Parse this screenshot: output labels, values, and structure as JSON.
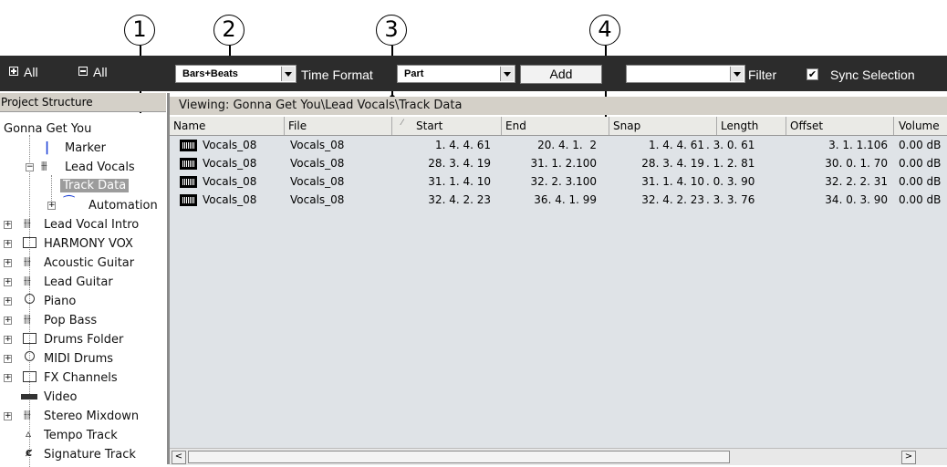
{
  "callouts": [
    "1",
    "2",
    "3",
    "4"
  ],
  "toolbar": {
    "expand_all": "All",
    "collapse_all": "All",
    "time_format_value": "Bars+Beats",
    "time_format_label": "Time Format",
    "type_value": "Part",
    "add_label": "Add",
    "filter_value": "",
    "filter_label": "Filter",
    "sync_label": "Sync Selection",
    "sync_checked": "✔"
  },
  "project_structure": {
    "header": "Project Structure",
    "root": "Gonna Get You",
    "items": [
      {
        "label": "Marker",
        "icon": "marker-icon"
      },
      {
        "label": "Lead Vocals",
        "icon": "audio-track-icon"
      },
      {
        "label": "Track Data",
        "icon": "none"
      },
      {
        "label": "Automation",
        "icon": "automation-icon"
      },
      {
        "label": "Lead Vocal Intro",
        "icon": "audio-track-icon"
      },
      {
        "label": "HARMONY VOX",
        "icon": "folder-icon"
      },
      {
        "label": "Acoustic Guitar",
        "icon": "audio-track-icon"
      },
      {
        "label": "Lead Guitar",
        "icon": "audio-track-icon"
      },
      {
        "label": "Piano",
        "icon": "midi-track-icon"
      },
      {
        "label": "Pop Bass",
        "icon": "audio-track-icon"
      },
      {
        "label": "Drums Folder",
        "icon": "folder-icon"
      },
      {
        "label": "MIDI Drums",
        "icon": "midi-track-icon"
      },
      {
        "label": "FX Channels",
        "icon": "folder-icon"
      },
      {
        "label": "Video",
        "icon": "video-icon"
      },
      {
        "label": "Stereo Mixdown",
        "icon": "audio-track-icon"
      },
      {
        "label": "Tempo Track",
        "icon": "tempo-icon"
      },
      {
        "label": "Signature Track",
        "icon": "signature-icon"
      }
    ]
  },
  "viewing": "Viewing: Gonna Get You\\Lead Vocals\\Track Data",
  "columns": [
    "Name",
    "File",
    "Start",
    "End",
    "Snap",
    "Length",
    "Offset",
    "Volume"
  ],
  "rows": [
    {
      "name": "Vocals_08",
      "file": "Vocals_08",
      "start": "1. 4. 4. 61",
      "end": "20. 4. 1.  2",
      "snap": "1. 4. 4. 61",
      "length": ". 3. 0. 61",
      "offset": "3. 1. 1.106",
      "volume": "0.00 dB"
    },
    {
      "name": "Vocals_08",
      "file": "Vocals_08",
      "start": "28. 3. 4. 19",
      "end": "31. 1. 2.100",
      "snap": "28. 3. 4. 19",
      "length": ". 1. 2. 81",
      "offset": "30. 0. 1. 70",
      "volume": "0.00 dB"
    },
    {
      "name": "Vocals_08",
      "file": "Vocals_08",
      "start": "31. 1. 4. 10",
      "end": "32. 2. 3.100",
      "snap": "31. 1. 4. 10",
      "length": ". 0. 3. 90",
      "offset": "32. 2. 2. 31",
      "volume": "0.00 dB"
    },
    {
      "name": "Vocals_08",
      "file": "Vocals_08",
      "start": "32. 4. 2. 23",
      "end": "36. 4. 1. 99",
      "snap": "32. 4. 2. 23",
      "length": ". 3. 3. 76",
      "offset": "34. 0. 3. 90",
      "volume": "0.00 dB"
    }
  ]
}
